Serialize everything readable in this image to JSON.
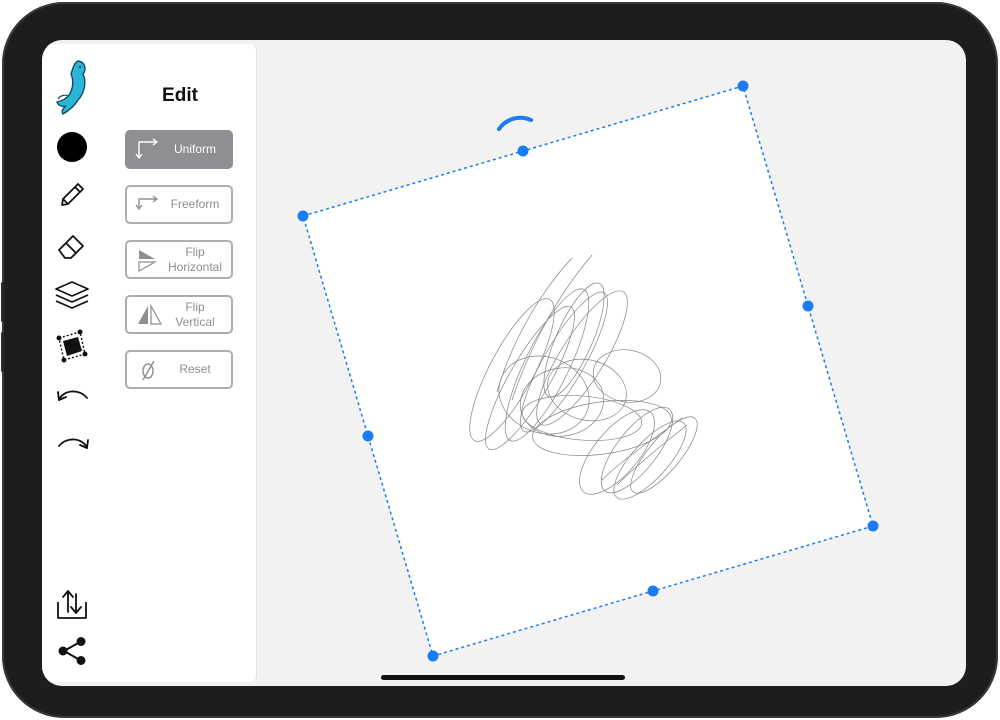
{
  "device": {
    "type": "iPad"
  },
  "colors": {
    "accent": "#1a7cf2",
    "toolbar_bg": "#ffffff",
    "canvas_bg": "#f2f2f3",
    "button_active_bg": "#8e8e93",
    "button_border": "#aeaeb2",
    "button_text": "#8e8e93",
    "selected_color": "#000000"
  },
  "toolbar": {
    "logo_icon": "dolphin-logo-icon",
    "tools": [
      {
        "name": "color-swatch",
        "icon": "filled-circle"
      },
      {
        "name": "pencil-tool",
        "icon": "pencil-icon"
      },
      {
        "name": "eraser-tool",
        "icon": "eraser-icon"
      },
      {
        "name": "layers-tool",
        "icon": "layers-icon"
      },
      {
        "name": "transform-tool",
        "icon": "transform-selection-icon",
        "selected": true
      },
      {
        "name": "undo-button",
        "icon": "undo-arrow-icon"
      },
      {
        "name": "redo-button",
        "icon": "redo-arrow-icon"
      },
      {
        "name": "export-button",
        "icon": "export-tray-icon"
      },
      {
        "name": "share-button",
        "icon": "share-nodes-icon"
      }
    ]
  },
  "edit_panel": {
    "title": "Edit",
    "buttons": [
      {
        "label": "Uniform",
        "icon": "uniform-scale-icon",
        "active": true
      },
      {
        "label": "Freeform",
        "icon": "freeform-scale-icon",
        "active": false
      },
      {
        "label": "Flip Horizontal",
        "line1": "Flip",
        "line2": "Horizontal",
        "icon": "flip-horizontal-icon",
        "active": false
      },
      {
        "label": "Flip Vertical",
        "line1": "Flip",
        "line2": "Vertical",
        "icon": "flip-vertical-icon",
        "active": false
      },
      {
        "label": "Reset",
        "icon": "reset-empty-set-icon",
        "active": false
      }
    ]
  },
  "canvas": {
    "selection": {
      "handles": 8,
      "rotate_handle_icon": "rotate-arc-icon",
      "style": "dashed"
    },
    "content": "pencil-scribble"
  }
}
